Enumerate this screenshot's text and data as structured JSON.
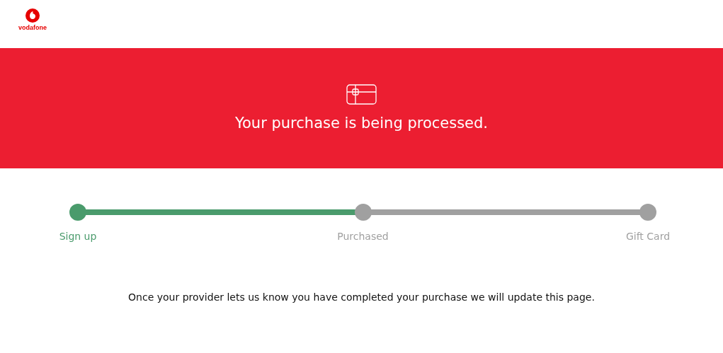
{
  "header": {
    "brand": "vodafone"
  },
  "banner": {
    "title": "Your purchase is being processed."
  },
  "steps": [
    {
      "label": "Sign up",
      "done": true
    },
    {
      "label": "Purchased",
      "done": false
    },
    {
      "label": "Gift Card",
      "done": false
    }
  ],
  "message": "Once your provider lets us know you have completed your purchase we will update this page."
}
